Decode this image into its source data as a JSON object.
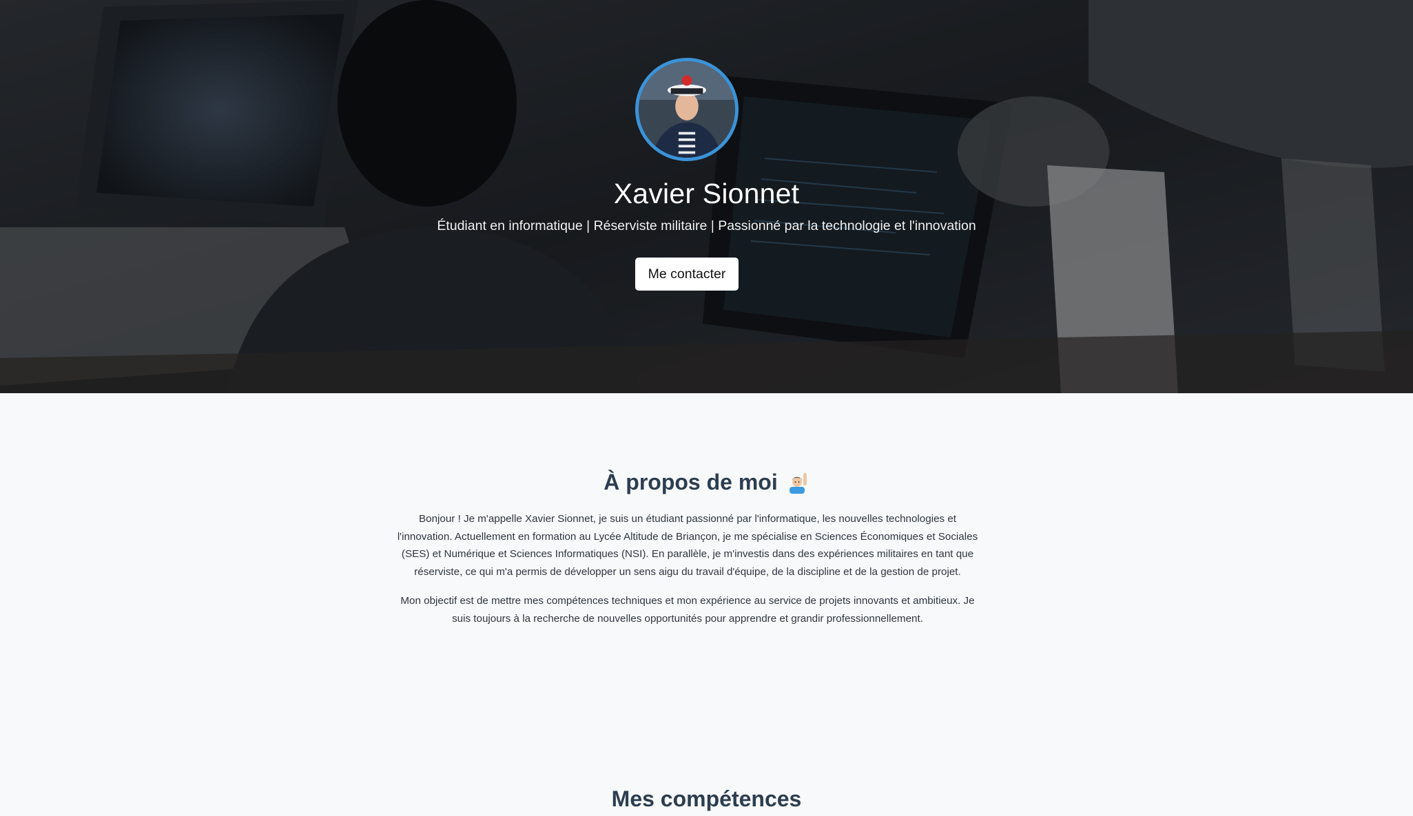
{
  "hero": {
    "name": "Xavier Sionnet",
    "tagline": "Étudiant en informatique | Réserviste militaire | Passionné par la technologie et l'innovation",
    "contact_button": "Me contacter",
    "avatar_alt": "avatar-photo"
  },
  "about": {
    "title": "À propos de moi",
    "emoji_icon": "person-raising-hand-icon",
    "paragraphs": [
      "Bonjour ! Je m'appelle Xavier Sionnet, je suis un étudiant passionné par l'informatique, les nouvelles technologies et l'innovation. Actuellement en formation au Lycée Altitude de Briançon, je me spécialise en Sciences Économiques et Sociales (SES) et Numérique et Sciences Informatiques (NSI). En parallèle, je m'investis dans des expériences militaires en tant que réserviste, ce qui m'a permis de développer un sens aigu du travail d'équipe, de la discipline et de la gestion de projet.",
      "Mon objectif est de mettre mes compétences techniques et mon expérience au service de projets innovants et ambitieux. Je suis toujours à la recherche de nouvelles opportunités pour apprendre et grandir professionnellement."
    ]
  },
  "skills": {
    "title": "Mes compétences"
  },
  "colors": {
    "avatar_border": "#3b93d8",
    "heading": "#2c3e50",
    "page_bg": "#f8f9fb"
  }
}
